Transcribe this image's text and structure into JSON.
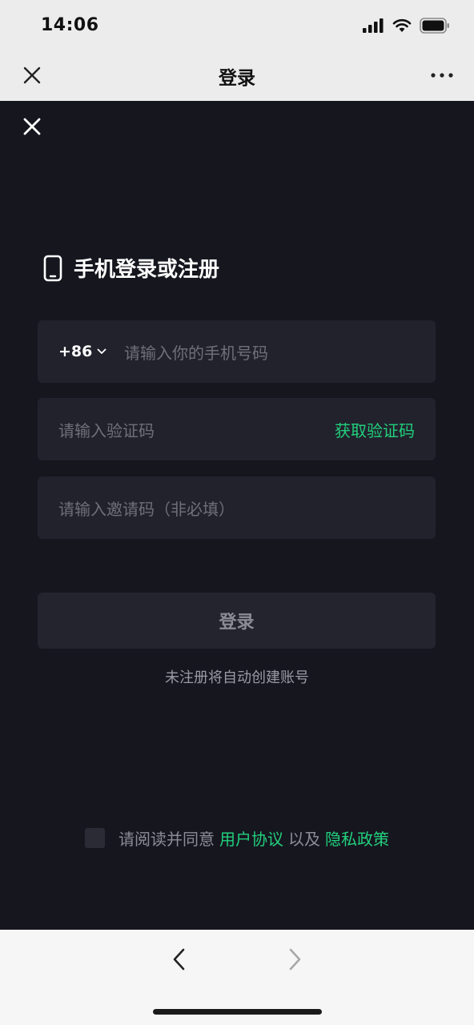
{
  "status_bar": {
    "time": "14:06"
  },
  "nav": {
    "title": "登录"
  },
  "page": {
    "heading": "手机登录或注册",
    "phone": {
      "prefix": "+86",
      "placeholder": "请输入你的手机号码"
    },
    "code": {
      "placeholder": "请输入验证码",
      "action": "获取验证码"
    },
    "invite": {
      "placeholder": "请输入邀请码（非必填）"
    },
    "login_button": "登录",
    "hint": "未注册将自动创建账号",
    "agreement": {
      "prefix": "请阅读并同意",
      "user_agreement": "用户协议",
      "and": "以及",
      "privacy_policy": "隐私政策"
    }
  },
  "colors": {
    "accent": "#21d07c",
    "background": "#16161f",
    "field": "#22222d"
  },
  "icons": [
    "close-icon",
    "more-icon",
    "phone-icon",
    "chevron-down-icon",
    "back-arrow-icon",
    "forward-arrow-icon",
    "signal-icon",
    "wifi-icon",
    "battery-icon"
  ]
}
